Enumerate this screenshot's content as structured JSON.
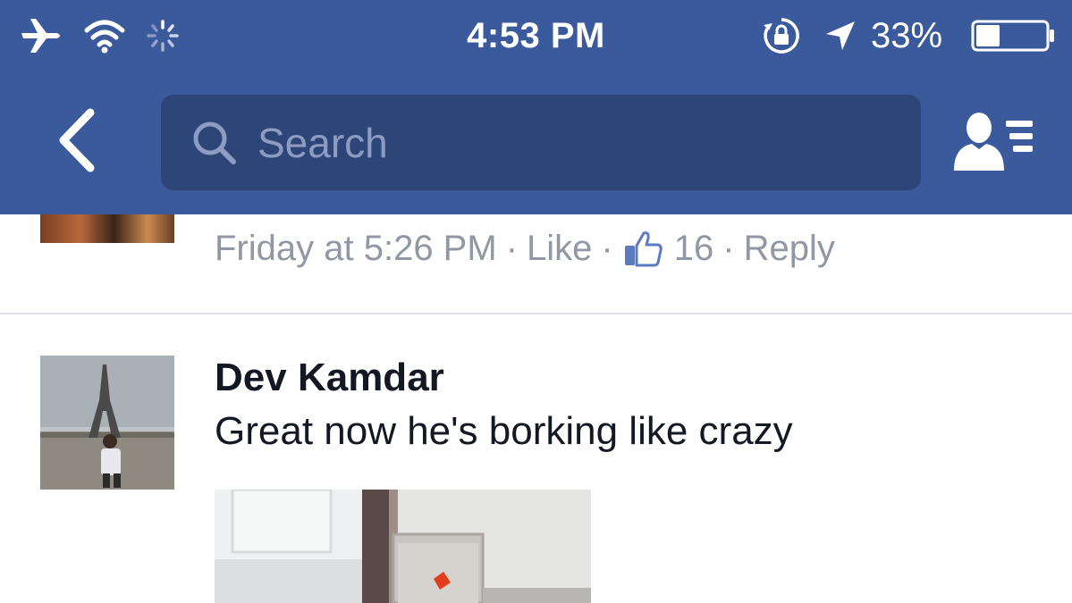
{
  "status_bar": {
    "time": "4:53 PM",
    "battery_percent": "33%",
    "icons": [
      "airplane-icon",
      "wifi-icon",
      "activity-spinner-icon",
      "rotation-lock-icon",
      "location-arrow-icon",
      "battery-icon"
    ]
  },
  "nav_bar": {
    "back_icon": "chevron-left-icon",
    "search_placeholder": "Search",
    "search_icon": "search-icon",
    "friends_icon": "friend-list-icon",
    "color": "#3b5a9c",
    "search_bg": "#2d4677"
  },
  "previous_comment": {
    "timestamp": "Friday at 5:26 PM",
    "separator": "·",
    "like_label": "Like",
    "like_count": "16",
    "reply_label": "Reply"
  },
  "comment": {
    "author": "Dev Kamdar",
    "text": "Great now he's borking like crazy"
  }
}
